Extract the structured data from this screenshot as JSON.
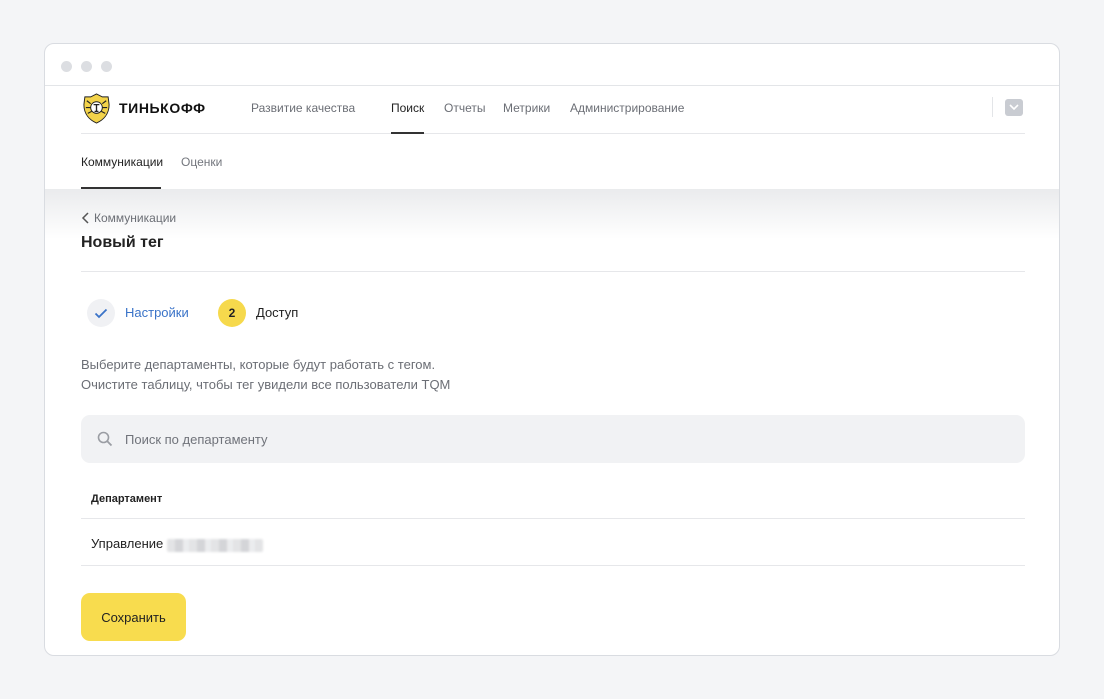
{
  "app": {
    "logo_text": "ТИНЬКОФФ",
    "brand_color": "#f8dc4e"
  },
  "topnav": {
    "items": [
      {
        "label": "Развитие качества",
        "active": false
      },
      {
        "label": "Поиск",
        "active": true
      },
      {
        "label": "Отчеты",
        "active": false
      },
      {
        "label": "Метрики",
        "active": false
      },
      {
        "label": "Администрирование",
        "active": false
      }
    ],
    "user_icon": "chevron-down-icon"
  },
  "subnav": {
    "items": [
      {
        "label": "Коммуникации",
        "active": true
      },
      {
        "label": "Оценки",
        "active": false
      }
    ]
  },
  "breadcrumb": {
    "label": "Коммуникации"
  },
  "page": {
    "title": "Новый тег"
  },
  "steps": [
    {
      "label": "Настройки",
      "status": "done",
      "icon": "check-icon"
    },
    {
      "number": "2",
      "label": "Доступ",
      "status": "current"
    }
  ],
  "description": {
    "line1": "Выберите департаменты, которые будут работать с тегом.",
    "line2": "Очистите таблицу, чтобы тег увидели все пользователи TQM"
  },
  "search": {
    "placeholder": "Поиск по департаменту",
    "value": "",
    "icon": "search-icon"
  },
  "table": {
    "columns": [
      "Департамент"
    ],
    "rows": [
      {
        "department": "Управление"
      }
    ]
  },
  "actions": {
    "save_label": "Сохранить"
  }
}
